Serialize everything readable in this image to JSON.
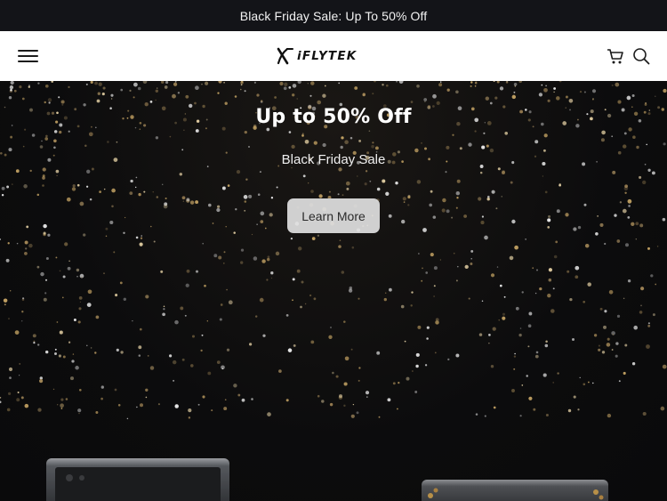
{
  "announcement": {
    "text": "Black Friday Sale: Up To 50% Off"
  },
  "header": {
    "logo_text": "iFLYTEK",
    "menu_icon": "hamburger-menu-icon",
    "cart_icon": "shopping-cart-icon",
    "search_icon": "search-icon"
  },
  "hero": {
    "title": "Up to 50% Off",
    "subtitle": "Black Friday Sale",
    "cta_label": "Learn More"
  },
  "colors": {
    "announcement_bg": "#131418",
    "header_bg": "#ffffff",
    "hero_bg": "#0b0b0c",
    "sparkle_gold": "#c9a766",
    "button_bg": "#e1e1e1"
  }
}
